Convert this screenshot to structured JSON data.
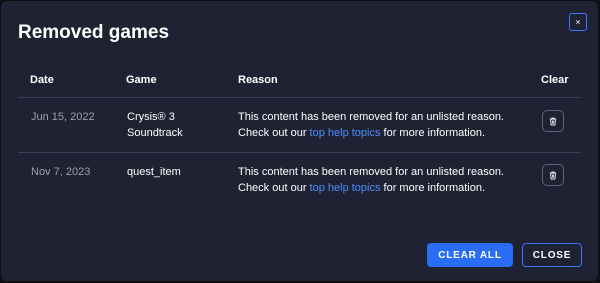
{
  "dialog": {
    "title": "Removed games",
    "close_icon": "close-icon"
  },
  "table": {
    "headers": {
      "date": "Date",
      "game": "Game",
      "reason": "Reason",
      "clear": "Clear"
    },
    "rows": [
      {
        "date": "Jun 15, 2022",
        "game_line1": "Crysis® 3",
        "game_line2": "Soundtrack",
        "reason_line1": "This content has been removed for an unlisted reason.",
        "reason_prefix": "Check out our ",
        "reason_link": "top help topics",
        "reason_suffix": " for more information.",
        "clear_icon": "trash-icon"
      },
      {
        "date": "Nov 7, 2023",
        "game_line1": "quest_item",
        "game_line2": "",
        "reason_line1": "This content has been removed for an unlisted reason.",
        "reason_prefix": "Check out our ",
        "reason_link": "top help topics",
        "reason_suffix": " for more information.",
        "clear_icon": "trash-icon"
      }
    ]
  },
  "actions": {
    "clear_all": "CLEAR ALL",
    "close": "CLOSE"
  },
  "colors": {
    "background": "#1f2233",
    "accent": "#2a6df5",
    "link": "#4d8dff",
    "muted": "#9b9fae"
  }
}
